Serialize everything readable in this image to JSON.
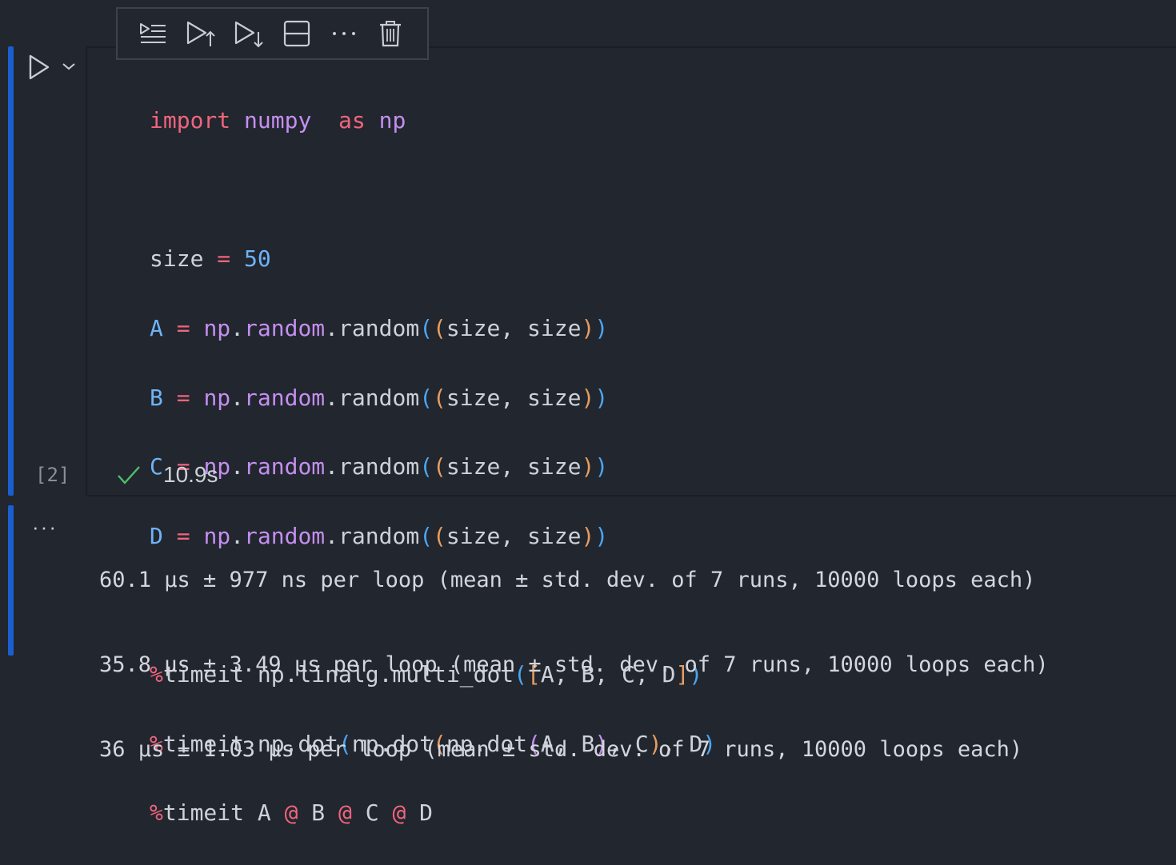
{
  "toolbar": {
    "buttons": [
      {
        "icon": "run-by-line-icon",
        "title": "Run by Line"
      },
      {
        "icon": "run-above-icon",
        "title": "Execute Above Cells"
      },
      {
        "icon": "run-below-icon",
        "title": "Execute Cell and Below"
      },
      {
        "icon": "split-cell-icon",
        "title": "Split Cell"
      },
      {
        "icon": "more-actions-icon",
        "title": "More Actions"
      },
      {
        "icon": "trash-icon",
        "title": "Delete Cell"
      }
    ]
  },
  "cell": {
    "run_icon": "play-icon",
    "run_menu_icon": "chevron-down-icon",
    "execution_count": "[2]",
    "status_icon": "check-icon",
    "status_color": "#4fbf6a",
    "duration": "10.9s",
    "code": {
      "line1": {
        "kw1": "import",
        "mod": "numpy",
        "kw2": "as",
        "alias": "np"
      },
      "line3": {
        "name": "size",
        "eq": "=",
        "value": "50"
      },
      "assignments": [
        {
          "var": "A",
          "eq": "=",
          "np": "np",
          "dot1": ".",
          "random": "random",
          "dot2": ".",
          "func": "random",
          "open1": "(",
          "open2": "(",
          "args": "size, size",
          "close2": ")",
          "close1": ")"
        },
        {
          "var": "B",
          "eq": "=",
          "np": "np",
          "dot1": ".",
          "random": "random",
          "dot2": ".",
          "func": "random",
          "open1": "(",
          "open2": "(",
          "args": "size, size",
          "close2": ")",
          "close1": ")"
        },
        {
          "var": "C",
          "eq": "=",
          "np": "np",
          "dot1": ".",
          "random": "random",
          "dot2": ".",
          "func": "random",
          "open1": "(",
          "open2": "(",
          "args": "size, size",
          "close2": ")",
          "close1": ")"
        },
        {
          "var": "D",
          "eq": "=",
          "np": "np",
          "dot1": ".",
          "random": "random",
          "dot2": ".",
          "func": "random",
          "open1": "(",
          "open2": "(",
          "args": "size, size",
          "close2": ")",
          "close1": ")"
        }
      ],
      "timeit1": {
        "pct": "%",
        "cmd": "timeit np.linalg.multi_dot",
        "o1": "(",
        "o2": "[",
        "args": "A, B, C, D",
        "c2": "]",
        "c1": ")"
      },
      "timeit2": {
        "pct": "%",
        "cmd": "timeit np.dot",
        "o1": "(",
        "mid1": "np.dot",
        "o2": "(",
        "mid2": "np.dot",
        "o3": "(",
        "args": "A, B",
        "c3": ")",
        "sep1": ", C",
        "c2": ")",
        "sep2": ", D",
        "c1": ")"
      },
      "timeit3": {
        "pct": "%",
        "cmd": "timeit A ",
        "at1": "@",
        "b": " B ",
        "at2": "@",
        "c": " C ",
        "at3": "@",
        "d": " D"
      }
    }
  },
  "output": {
    "more_icon": "ellipsis-icon",
    "lines": [
      "60.1 µs ± 977 ns per loop (mean ± std. dev. of 7 runs, 10000 loops each)",
      "35.8 µs ± 3.49 µs per loop (mean ± std. dev. of 7 runs, 10000 loops each)",
      "36 µs ± 1.03 µs per loop (mean ± std. dev. of 7 runs, 10000 loops each)"
    ]
  }
}
